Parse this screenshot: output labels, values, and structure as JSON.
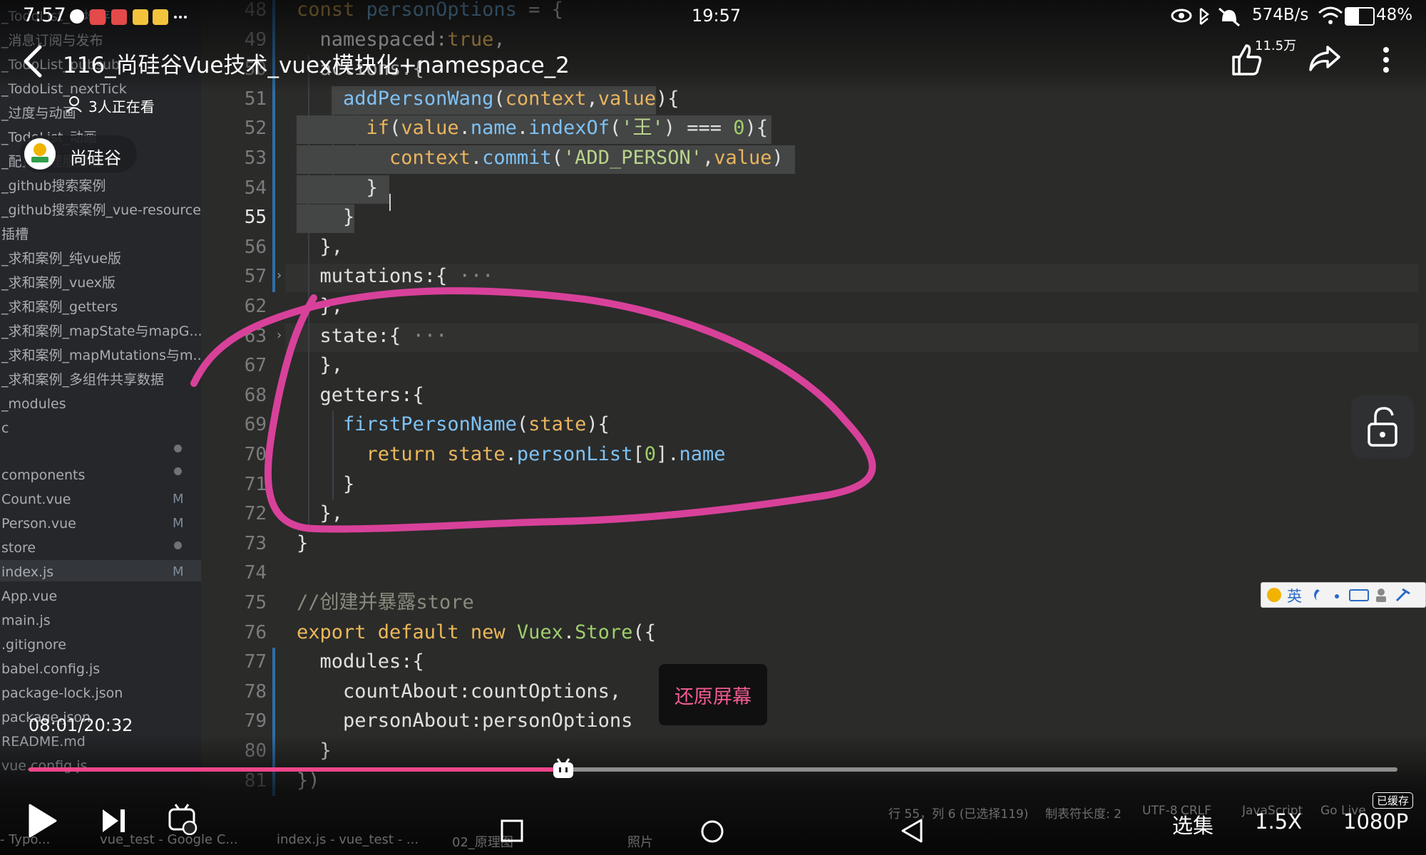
{
  "status_bar": {
    "time_left": "7:57",
    "time_center": "19:57",
    "net_speed": "574B/s",
    "battery": "48%"
  },
  "video": {
    "title": "116_尚硅谷Vue技术_vuex模块化+namespace_2",
    "viewers": "3人正在看",
    "uploader": "尚硅谷",
    "likes": "11.5万",
    "time": "08:01/20:32",
    "progress": 0.3906,
    "restore_label": "还原屏幕",
    "cached_badge": "已缓存",
    "episodes_label": "选集",
    "speed_label": "1.5X",
    "quality_label": "1080P"
  },
  "sidebar": {
    "items": [
      {
        "label": "_TodoList_本地存储"
      },
      {
        "label": "_消息订阅与发布"
      },
      {
        "label": "_TodoList_pubsub"
      },
      {
        "label": "_TodoList_nextTick"
      },
      {
        "label": "_过度与动画"
      },
      {
        "label": "_TodoList_动画"
      },
      {
        "label": "_配置代理服务器"
      },
      {
        "label": "_github搜索案例"
      },
      {
        "label": "_github搜索案例_vue-resource"
      },
      {
        "label": "插槽"
      },
      {
        "label": "_求和案例_纯vue版"
      },
      {
        "label": "_求和案例_vuex版"
      },
      {
        "label": "_求和案例_getters"
      },
      {
        "label": "_求和案例_mapState与mapG..."
      },
      {
        "label": "_求和案例_mapMutations与m..."
      },
      {
        "label": "_求和案例_多组件共享数据"
      },
      {
        "label": "_modules"
      },
      {
        "label": "c"
      },
      {
        "label": "components"
      },
      {
        "label": "Count.vue"
      },
      {
        "label": "Person.vue"
      },
      {
        "label": "store"
      },
      {
        "label": "index.js"
      },
      {
        "label": "App.vue"
      },
      {
        "label": "main.js"
      },
      {
        "label": ".gitignore"
      },
      {
        "label": "babel.config.js"
      },
      {
        "label": "package-lock.json"
      },
      {
        "label": "package.json"
      },
      {
        "label": "README.md"
      },
      {
        "label": "vue.config.js"
      }
    ],
    "mod_marker": "M"
  },
  "code": {
    "lines": [
      {
        "n": "48",
        "tokens": [
          [
            "k",
            "const "
          ],
          [
            "f",
            "personOptions"
          ],
          [
            "n",
            " = {"
          ]
        ]
      },
      {
        "n": "49",
        "tokens": [
          [
            "n",
            "  namespaced:"
          ],
          [
            "k",
            "true"
          ],
          [
            "n",
            ","
          ]
        ]
      },
      {
        "n": "50",
        "tokens": [
          [
            "n",
            "  actions:{"
          ]
        ]
      },
      {
        "n": "51",
        "tokens": [
          [
            "n",
            "    "
          ],
          [
            "f",
            "addPersonWang"
          ],
          [
            "n",
            "("
          ],
          [
            "p",
            "context"
          ],
          [
            "n",
            ","
          ],
          [
            "p",
            "value"
          ],
          [
            "n",
            "){"
          ]
        ]
      },
      {
        "n": "52",
        "tokens": [
          [
            "n",
            "      "
          ],
          [
            "k",
            "if"
          ],
          [
            "n",
            "("
          ],
          [
            "p",
            "value"
          ],
          [
            "n",
            "."
          ],
          [
            "f",
            "name"
          ],
          [
            "n",
            "."
          ],
          [
            "f",
            "indexOf"
          ],
          [
            "n",
            "("
          ],
          [
            "s",
            "'王'"
          ],
          [
            "n",
            ") === "
          ],
          [
            "g",
            "0"
          ],
          [
            "n",
            "){"
          ]
        ]
      },
      {
        "n": "53",
        "tokens": [
          [
            "n",
            "        "
          ],
          [
            "p",
            "context"
          ],
          [
            "n",
            "."
          ],
          [
            "f",
            "commit"
          ],
          [
            "n",
            "("
          ],
          [
            "s",
            "'ADD_PERSON'"
          ],
          [
            "n",
            ","
          ],
          [
            "p",
            "value"
          ],
          [
            "n",
            ")"
          ]
        ]
      },
      {
        "n": "54",
        "tokens": [
          [
            "n",
            "      }"
          ]
        ]
      },
      {
        "n": "55",
        "tokens": [
          [
            "n",
            "    }"
          ]
        ]
      },
      {
        "n": "56",
        "tokens": [
          [
            "n",
            "  },"
          ]
        ]
      },
      {
        "n": "57",
        "tokens": [
          [
            "n",
            "  mutations:{ "
          ],
          [
            "c",
            "···"
          ]
        ]
      },
      {
        "n": "62",
        "tokens": [
          [
            "n",
            "  },"
          ]
        ]
      },
      {
        "n": "63",
        "tokens": [
          [
            "n",
            "  state:{ "
          ],
          [
            "c",
            "···"
          ]
        ]
      },
      {
        "n": "67",
        "tokens": [
          [
            "n",
            "  },"
          ]
        ]
      },
      {
        "n": "68",
        "tokens": [
          [
            "n",
            "  getters:{"
          ]
        ]
      },
      {
        "n": "69",
        "tokens": [
          [
            "n",
            "    "
          ],
          [
            "f",
            "firstPersonName"
          ],
          [
            "n",
            "("
          ],
          [
            "p",
            "state"
          ],
          [
            "n",
            "){"
          ]
        ]
      },
      {
        "n": "70",
        "tokens": [
          [
            "n",
            "      "
          ],
          [
            "k",
            "return "
          ],
          [
            "p",
            "state"
          ],
          [
            "n",
            "."
          ],
          [
            "f",
            "personList"
          ],
          [
            "n",
            "["
          ],
          [
            "g",
            "0"
          ],
          [
            "n",
            "]."
          ],
          [
            "f",
            "name"
          ]
        ]
      },
      {
        "n": "71",
        "tokens": [
          [
            "n",
            "    }"
          ]
        ]
      },
      {
        "n": "72",
        "tokens": [
          [
            "n",
            "  },"
          ]
        ]
      },
      {
        "n": "73",
        "tokens": [
          [
            "n",
            "}"
          ]
        ]
      },
      {
        "n": "74",
        "tokens": []
      },
      {
        "n": "75",
        "tokens": [
          [
            "c",
            "//创建并暴露store"
          ]
        ]
      },
      {
        "n": "76",
        "tokens": [
          [
            "k",
            "export default new "
          ],
          [
            "g",
            "Vuex"
          ],
          [
            "n",
            "."
          ],
          [
            "g",
            "Store"
          ],
          [
            "n",
            "({"
          ]
        ]
      },
      {
        "n": "77",
        "tokens": [
          [
            "n",
            "  modules:{"
          ]
        ]
      },
      {
        "n": "78",
        "tokens": [
          [
            "n",
            "    countAbout:countOptions,"
          ]
        ]
      },
      {
        "n": "79",
        "tokens": [
          [
            "n",
            "    personAbout:personOptions"
          ]
        ]
      },
      {
        "n": "80",
        "tokens": [
          [
            "n",
            "  }"
          ]
        ]
      },
      {
        "n": "81",
        "tokens": [
          [
            "n",
            "})"
          ]
        ]
      }
    ],
    "active_line": "55"
  },
  "editor_status": {
    "position": "行 55，列 6 (已选择119)",
    "tab_size": "制表符长度: 2",
    "encoding": "UTF-8",
    "eol": "CRLF",
    "language": "JavaScript",
    "go_live": "Go Live"
  },
  "taskbar": {
    "items": [
      "- Typo...",
      "vue_test - Google C...",
      "index.js - vue_test - ...",
      "02_原理图",
      "照片"
    ]
  },
  "ime": {
    "lang": "英"
  },
  "colors": {
    "accent_pink": "#f2468a",
    "annotation_pink": "#d8419a",
    "restore_text": "#f25b93"
  },
  "icons": [
    "back-arrow-icon",
    "viewers-icon",
    "like-icon",
    "share-icon",
    "more-icon",
    "lock-icon",
    "play-icon",
    "next-icon",
    "danmaku-icon",
    "home-square-icon",
    "home-circle-icon",
    "home-back-icon"
  ]
}
